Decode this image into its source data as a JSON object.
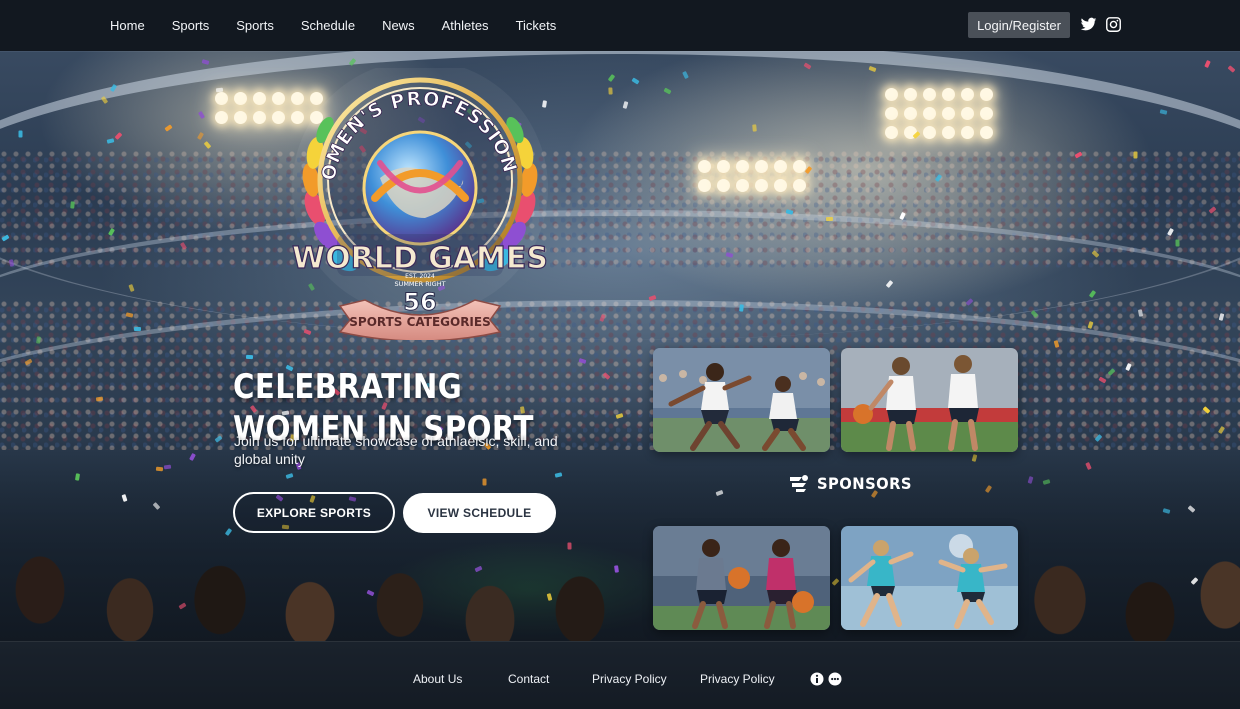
{
  "nav": {
    "items": [
      "Home",
      "Sports",
      "Sports",
      "Schedule",
      "News",
      "Athletes",
      "Tickets"
    ],
    "login_label": "Login/Register",
    "social_icons": [
      "twitter-icon",
      "instagram-icon"
    ]
  },
  "emblem": {
    "arc_text": "WOMEN'S PROFESSIONAL",
    "title": "WORLD GAMES",
    "small_line_1": "EST. 2024",
    "small_line_2": "SUMMER RIGHT",
    "number": "56",
    "ribbon_text": "SPORTS CATEGORIES"
  },
  "hero": {
    "title": "Celebrating Women in Sport",
    "subtitle": "Join us for ultimate showcase of athlaelsic, skill, and global unity",
    "explore_label": "EXPLORE SPORTS",
    "schedule_label": "VIEW SCHEDULE"
  },
  "sponsors": {
    "label": "SPONSORS"
  },
  "tiles": [
    {
      "name": "netball",
      "sky": "#6f8aa8",
      "jersey": "#f3f3f3"
    },
    {
      "name": "basketball-white",
      "sky": "#a9b4c0",
      "jersey": "#f4f4f4"
    },
    {
      "name": "basketball-dark",
      "sky": "#5a6e86",
      "jersey": "#c0306a"
    },
    {
      "name": "volleyball",
      "sky": "#7fa6c6",
      "jersey": "#38b6c8"
    }
  ],
  "footer": {
    "links": [
      "About Us",
      "Contact",
      "Privacy Policy",
      "Privacy Policy"
    ],
    "icons": [
      "circle-info-icon",
      "circle-more-icon"
    ]
  },
  "colors": {
    "header_bg": "#121820",
    "login_bg": "#4a5058",
    "footer_bg": "#141b24",
    "accent_white": "#ffffff"
  }
}
